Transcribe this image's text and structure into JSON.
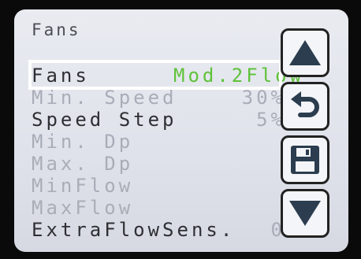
{
  "screen": {
    "title": "Fans"
  },
  "menu": {
    "items": [
      {
        "label": "Fans",
        "value": "Mod.2Flow",
        "state": "selected"
      },
      {
        "label": "Min. Speed",
        "value": "30%",
        "state": "disabled"
      },
      {
        "label": "Speed Step",
        "value": "5%",
        "state": "active"
      },
      {
        "label": "Min. Dp",
        "value": "",
        "state": "disabled"
      },
      {
        "label": "Max. Dp",
        "value": "",
        "state": "disabled"
      },
      {
        "label": "MinFlow",
        "value": "",
        "state": "disabled"
      },
      {
        "label": "MaxFlow",
        "value": "",
        "state": "disabled"
      },
      {
        "label": "ExtraFlowSens.",
        "value": "0",
        "state": "active"
      }
    ]
  },
  "buttons": [
    {
      "name": "up",
      "icon": "triangle-up-icon"
    },
    {
      "name": "back",
      "icon": "undo-arrow-icon"
    },
    {
      "name": "save",
      "icon": "floppy-disk-icon"
    },
    {
      "name": "down",
      "icon": "triangle-down-icon"
    }
  ],
  "colors": {
    "selected_value": "#5fc23a",
    "active_text": "#2e2f33",
    "disabled_text": "#a9adb8",
    "screen_bg": "#e3e6ed"
  }
}
